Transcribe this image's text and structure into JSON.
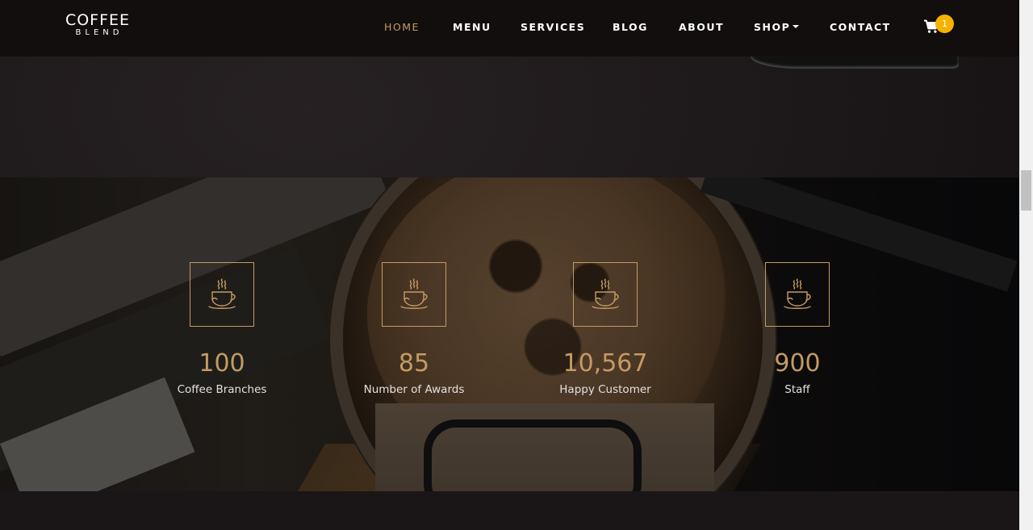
{
  "brand": {
    "top": "COFFEE",
    "bottom": "BLEND"
  },
  "nav": {
    "items": [
      {
        "label": "HOME",
        "active": true
      },
      {
        "label": "MENU",
        "active": false
      },
      {
        "label": "SERVICES",
        "active": false
      },
      {
        "label": "BLOG",
        "active": false
      },
      {
        "label": "ABOUT",
        "active": false
      },
      {
        "label": "SHOP",
        "active": false,
        "dropdown": true
      },
      {
        "label": "CONTACT",
        "active": false
      }
    ],
    "cart": {
      "icon": "shopping-cart-icon",
      "count": "1"
    }
  },
  "counters": [
    {
      "icon": "coffee-cup-icon",
      "number": "100",
      "label": "Coffee Branches"
    },
    {
      "icon": "coffee-cup-icon",
      "number": "85",
      "label": "Number of Awards"
    },
    {
      "icon": "coffee-cup-icon",
      "number": "10,567",
      "label": "Happy Customer"
    },
    {
      "icon": "coffee-cup-icon",
      "number": "900",
      "label": "Staff"
    }
  ],
  "colors": {
    "accent": "#c49b63",
    "navbar": "#120e0d",
    "badge": "#f5b301",
    "background": "#1a1617"
  }
}
